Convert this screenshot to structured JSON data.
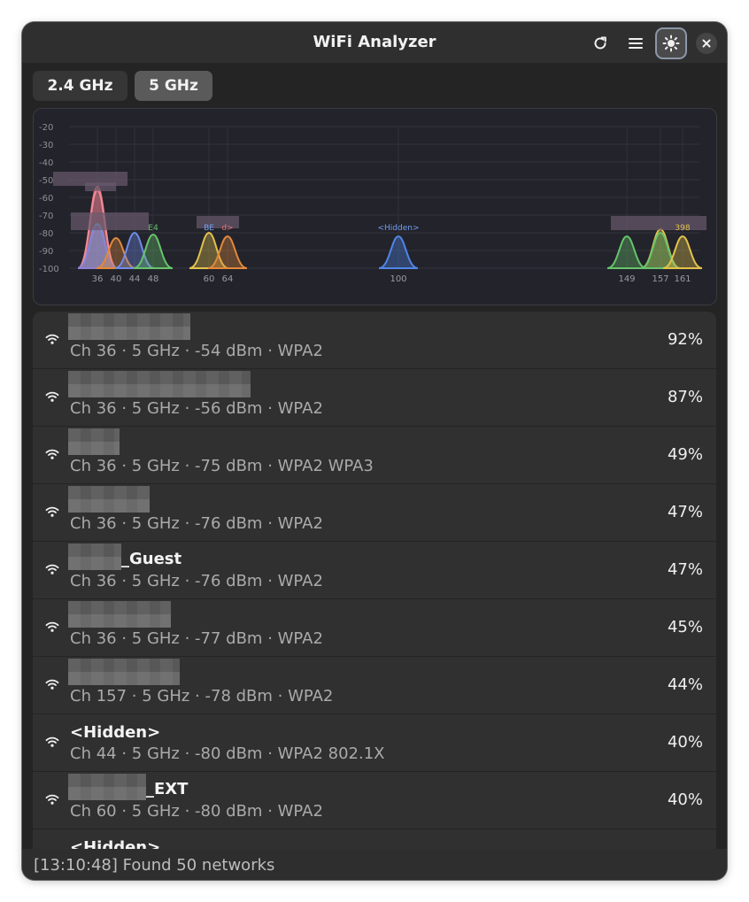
{
  "window": {
    "title": "WiFi Analyzer"
  },
  "toolbar": {
    "icons": [
      "refresh-icon",
      "menu-icon",
      "brightness-icon",
      "close-icon"
    ]
  },
  "tabs": [
    {
      "label": "2.4 GHz",
      "selected": false
    },
    {
      "label": "5 GHz",
      "selected": true
    }
  ],
  "chart_data": {
    "type": "area",
    "y_ticks": [
      "-20",
      "-30",
      "-40",
      "-50",
      "-60",
      "-70",
      "-80",
      "-90",
      "-100"
    ],
    "ylim": [
      -100,
      -20
    ],
    "x_ticks": [
      "36",
      "40",
      "44",
      "48",
      "60",
      "64",
      "100",
      "149",
      "157",
      "161"
    ],
    "grid": true,
    "series": [
      {
        "channel": 36,
        "dbm": -54,
        "color": "#e5737d"
      },
      {
        "channel": 36,
        "dbm": -56,
        "color": "#f08a9a"
      },
      {
        "channel": 36,
        "dbm": -75,
        "color": "#62c8e8"
      },
      {
        "channel": 36,
        "dbm": -76,
        "color": "#8d7fd6"
      },
      {
        "channel": 40,
        "dbm": -83,
        "color": "#e3893a"
      },
      {
        "channel": 44,
        "dbm": -80,
        "color": "#6f8ce8"
      },
      {
        "channel": 48,
        "dbm": -81,
        "color": "#67c36b"
      },
      {
        "channel": 60,
        "dbm": -80,
        "color": "#e3c24a"
      },
      {
        "channel": 64,
        "dbm": -82,
        "color": "#e3893a"
      },
      {
        "channel": 100,
        "dbm": -82,
        "color": "#4f86e8"
      },
      {
        "channel": 149,
        "dbm": -82,
        "color": "#67c36b"
      },
      {
        "channel": 157,
        "dbm": -78,
        "color": "#e3c24a"
      },
      {
        "channel": 157,
        "dbm": -80,
        "color": "#67c36b"
      },
      {
        "channel": 161,
        "dbm": -82,
        "color": "#e3c24a"
      }
    ],
    "annotations": [
      {
        "text": "<Hidden>",
        "channel": 100,
        "color": "#6fa0f0"
      },
      {
        "text": "E4",
        "channel": 48,
        "color": "#67c36b"
      },
      {
        "text": "BE",
        "channel": 60,
        "color": "#6fa0f0"
      },
      {
        "text": "d>",
        "channel": 64,
        "color": "#e5737d"
      },
      {
        "text": "398",
        "channel": 161,
        "color": "#e3c24a"
      }
    ]
  },
  "networks": [
    {
      "ssid": "",
      "ssid_suffix": "",
      "blur_width": 138,
      "details": "Ch 36 · 5 GHz · -54 dBm · WPA2",
      "strength": "92%"
    },
    {
      "ssid": "",
      "ssid_suffix": "",
      "blur_width": 206,
      "details": "Ch 36 · 5 GHz · -56 dBm · WPA2",
      "strength": "87%"
    },
    {
      "ssid": "",
      "ssid_suffix": "",
      "blur_width": 58,
      "details": "Ch 36 · 5 GHz · -75 dBm · WPA2 WPA3",
      "strength": "49%"
    },
    {
      "ssid": "",
      "ssid_suffix": "",
      "blur_width": 92,
      "details": "Ch 36 · 5 GHz · -76 dBm · WPA2",
      "strength": "47%"
    },
    {
      "ssid": "",
      "ssid_suffix": "_Guest",
      "blur_width": 60,
      "details": "Ch 36 · 5 GHz · -76 dBm · WPA2",
      "strength": "47%"
    },
    {
      "ssid": "",
      "ssid_suffix": "",
      "blur_width": 116,
      "details": "Ch 36 · 5 GHz · -77 dBm · WPA2",
      "strength": "45%"
    },
    {
      "ssid": "",
      "ssid_suffix": "",
      "blur_width": 126,
      "details": "Ch 157 · 5 GHz · -78 dBm · WPA2",
      "strength": "44%"
    },
    {
      "ssid": "<Hidden>",
      "ssid_suffix": "",
      "blur_width": 0,
      "details": "Ch 44 · 5 GHz · -80 dBm · WPA2 802.1X",
      "strength": "40%"
    },
    {
      "ssid": "",
      "ssid_suffix": "_EXT",
      "blur_width": 88,
      "details": "Ch 60 · 5 GHz · -80 dBm · WPA2",
      "strength": "40%"
    },
    {
      "ssid": "<Hidden>",
      "ssid_suffix": "",
      "blur_width": 0,
      "details": "",
      "strength": ""
    }
  ],
  "status": {
    "text": "[13:10:48] Found 50 networks"
  }
}
